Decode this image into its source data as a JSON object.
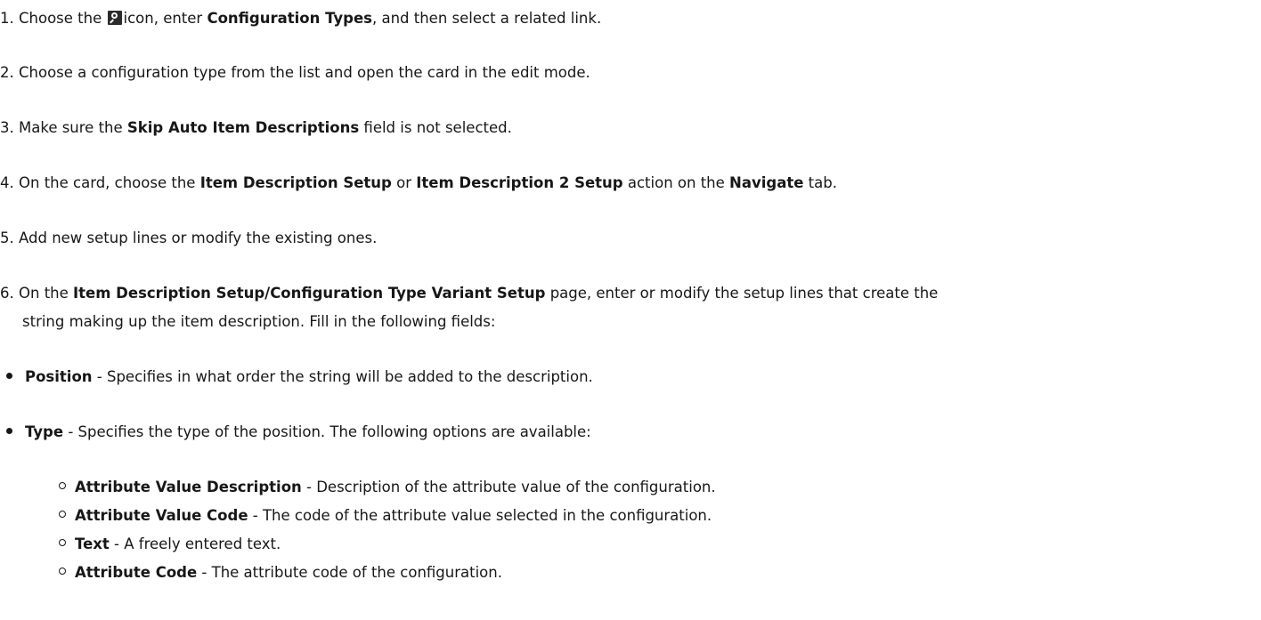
{
  "steps": [
    {
      "num": "1.",
      "pre": "Choose the",
      "mid": "icon, enter",
      "b1": "Configuration Types",
      "post": ", and then select a related link."
    },
    {
      "num": "2.",
      "text": "Choose a configuration type from the list and open the card in the edit mode."
    },
    {
      "num": "3.",
      "pre": "Make sure the",
      "b1": "Skip Auto Item Descriptions",
      "post": "field is not selected."
    },
    {
      "num": "4.",
      "pre": "On the card, choose the",
      "b1": "Item Description Setup",
      "mid": "or",
      "b2": "Item Description 2 Setup",
      "mid2": "action on the",
      "b3": "Navigate",
      "post": "tab."
    },
    {
      "num": "5.",
      "text": "Add new setup lines or modify the existing ones."
    },
    {
      "num": "6.",
      "pre": "On the",
      "b1": "Item Description Setup/Configuration Type Variant Setup",
      "post": "page, enter or modify the setup lines that create the",
      "cont": "string making up the item description. Fill in the following fields:"
    }
  ],
  "bullets": [
    {
      "term": "Position",
      "desc": "- Specifies in what order the string will be added to the description."
    },
    {
      "term": "Type",
      "desc": "- Specifies the type of the position. The following options are available:"
    }
  ],
  "sub_bullets": [
    {
      "term": "Attribute Value Description",
      "desc": "- Description of the attribute value of the configuration."
    },
    {
      "term": "Attribute Value Code",
      "desc": "- The code of the attribute value selected in the configuration."
    },
    {
      "term": "Text",
      "desc": "- A freely entered text."
    },
    {
      "term": "Attribute Code",
      "desc": "- The attribute code of the configuration."
    }
  ],
  "icons": {
    "step1_icon": "search-icon"
  }
}
